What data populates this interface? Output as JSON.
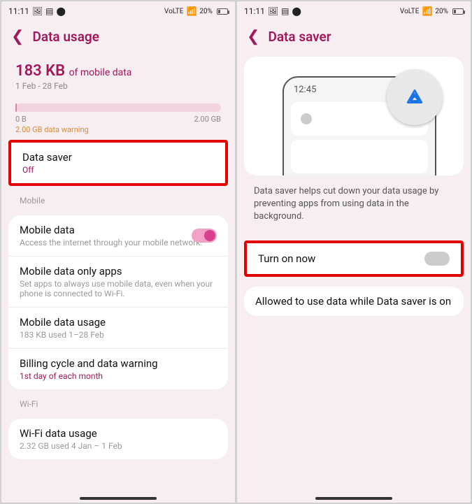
{
  "statusbar": {
    "time": "11:11",
    "net": "VoLTE",
    "signal": "▬",
    "battery_pct": "20%"
  },
  "screen1": {
    "title": "Data usage",
    "usage_amount": "183 KB",
    "usage_suffix": "of mobile data",
    "usage_range": "1 Feb - 28 Feb",
    "bar_min": "0 B",
    "bar_max": "2.00 GB",
    "warning": "2.00 GB data warning",
    "datasaver": {
      "title": "Data saver",
      "sub": "Off"
    },
    "mobile_section": "Mobile",
    "mobile_data": {
      "title": "Mobile data",
      "sub": "Access the internet through your mobile network."
    },
    "only_apps": {
      "title": "Mobile data only apps",
      "sub": "Set apps to always use mobile data, even when your phone is connected to Wi-Fi."
    },
    "mobile_usage": {
      "title": "Mobile data usage",
      "sub": "183 KB used 1–28 Feb"
    },
    "billing": {
      "title": "Billing cycle and data warning",
      "sub": "1st day of each month"
    },
    "wifi_section": "Wi-Fi",
    "wifi_usage": {
      "title": "Wi-Fi data usage",
      "sub": "2.32 GB used 4 Jan – 1 Feb"
    }
  },
  "screen2": {
    "title": "Data saver",
    "illus_time": "12:45",
    "desc": "Data saver helps cut down your data usage by preventing apps from using data in the background.",
    "turn_on": "Turn on now",
    "allowed": "Allowed to use data while Data saver is on"
  }
}
